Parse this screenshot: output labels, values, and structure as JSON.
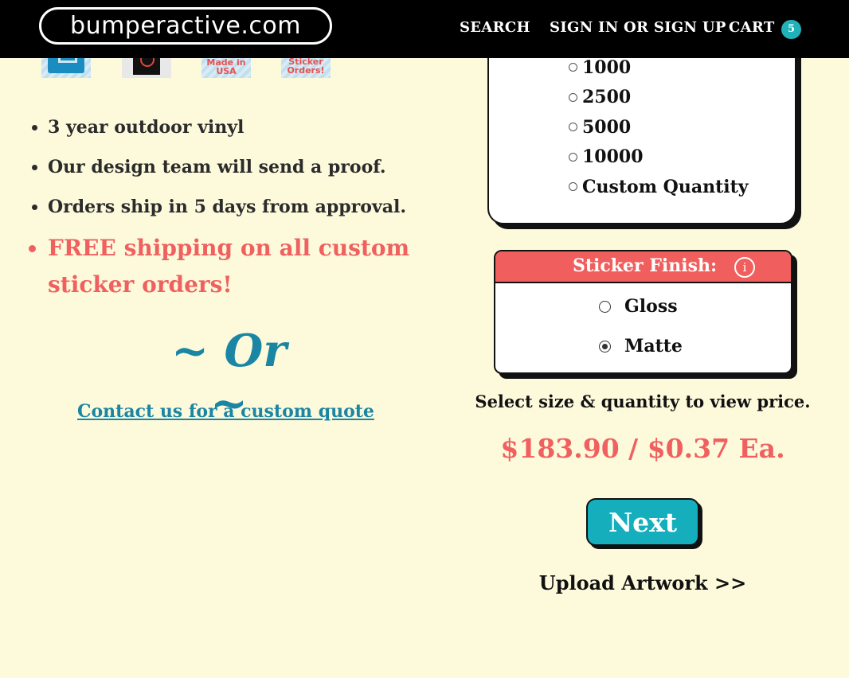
{
  "header": {
    "logo_text": "bumperactive.com",
    "nav": {
      "search": "SEARCH",
      "sign_in": "SIGN IN OR SIGN UP",
      "cart": "CART",
      "cart_count": "5"
    }
  },
  "thumbnails": [
    {
      "icon": "sticker-sample-icon"
    },
    {
      "icon": "sticker-sample-icon"
    },
    {
      "text": "Made in USA"
    },
    {
      "text": "Sticker Orders!"
    }
  ],
  "features": [
    "3 year outdoor vinyl",
    "Our design team will send a proof.",
    "Orders ship in 5 days from approval."
  ],
  "promo": "FREE shipping on all custom sticker orders!",
  "or_separator": "~ Or ~",
  "contact_link": "Contact us for a custom quote",
  "quantity": {
    "options": [
      "1000",
      "2500",
      "5000",
      "10000",
      "Custom Quantity"
    ]
  },
  "finish": {
    "title": "Sticker Finish:",
    "info_icon": "i",
    "options": [
      {
        "label": "Gloss",
        "selected": false
      },
      {
        "label": "Matte",
        "selected": true
      }
    ]
  },
  "price": {
    "hint": "Select size & quantity to view price.",
    "value": "$183.90 / $0.37 Ea."
  },
  "next_button": "Next",
  "upload_link": "Upload Artwork >>",
  "colors": {
    "background": "#fdfadc",
    "accent_red": "#f0605f",
    "accent_teal": "#15aebd",
    "link_blue": "#1a86a4"
  }
}
